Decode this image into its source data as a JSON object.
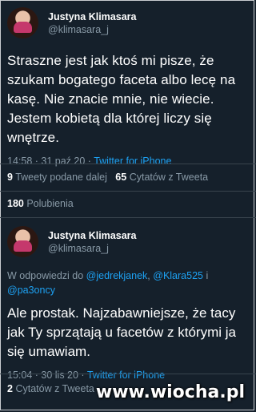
{
  "tweet1": {
    "name": "Justyna Klimasara",
    "handle": "@klimasara_j",
    "text": "Straszne jest jak ktoś mi pisze, że szukam bogatego faceta albo lecę na kasę. Nie znacie mnie, nie wiecie. Jestem kobietą dla której liczy się wnętrze.",
    "time": "14:58 · 31 paź 20 · ",
    "source": "Twitter for iPhone",
    "retweets": "9",
    "retweets_label": "Tweety podane dalej",
    "quotes": "65",
    "quotes_label": "Cytatów z Tweeta",
    "likes": "180",
    "likes_label": "Polubienia"
  },
  "tweet2": {
    "name": "Justyna Klimasara",
    "handle": "@klimasara_j",
    "reply_prefix": "W odpowiedzi do ",
    "mention1": "@jedrekjanek",
    "sep1": ", ",
    "mention2": "@Klara525",
    "sep2": " i",
    "mention3": "@pa3oncy",
    "text": "Ale prostak. Najzabawniejsze, że tacy jak Ty sprzątają u facetów z którymi ja się umawiam.",
    "time": "15:04 · 30 lis 20 · ",
    "source": "Twitter for iPhone",
    "quotes": "2",
    "quotes_label": "Cytatów z Tweeta"
  },
  "watermark": "www.wiocha.pl"
}
